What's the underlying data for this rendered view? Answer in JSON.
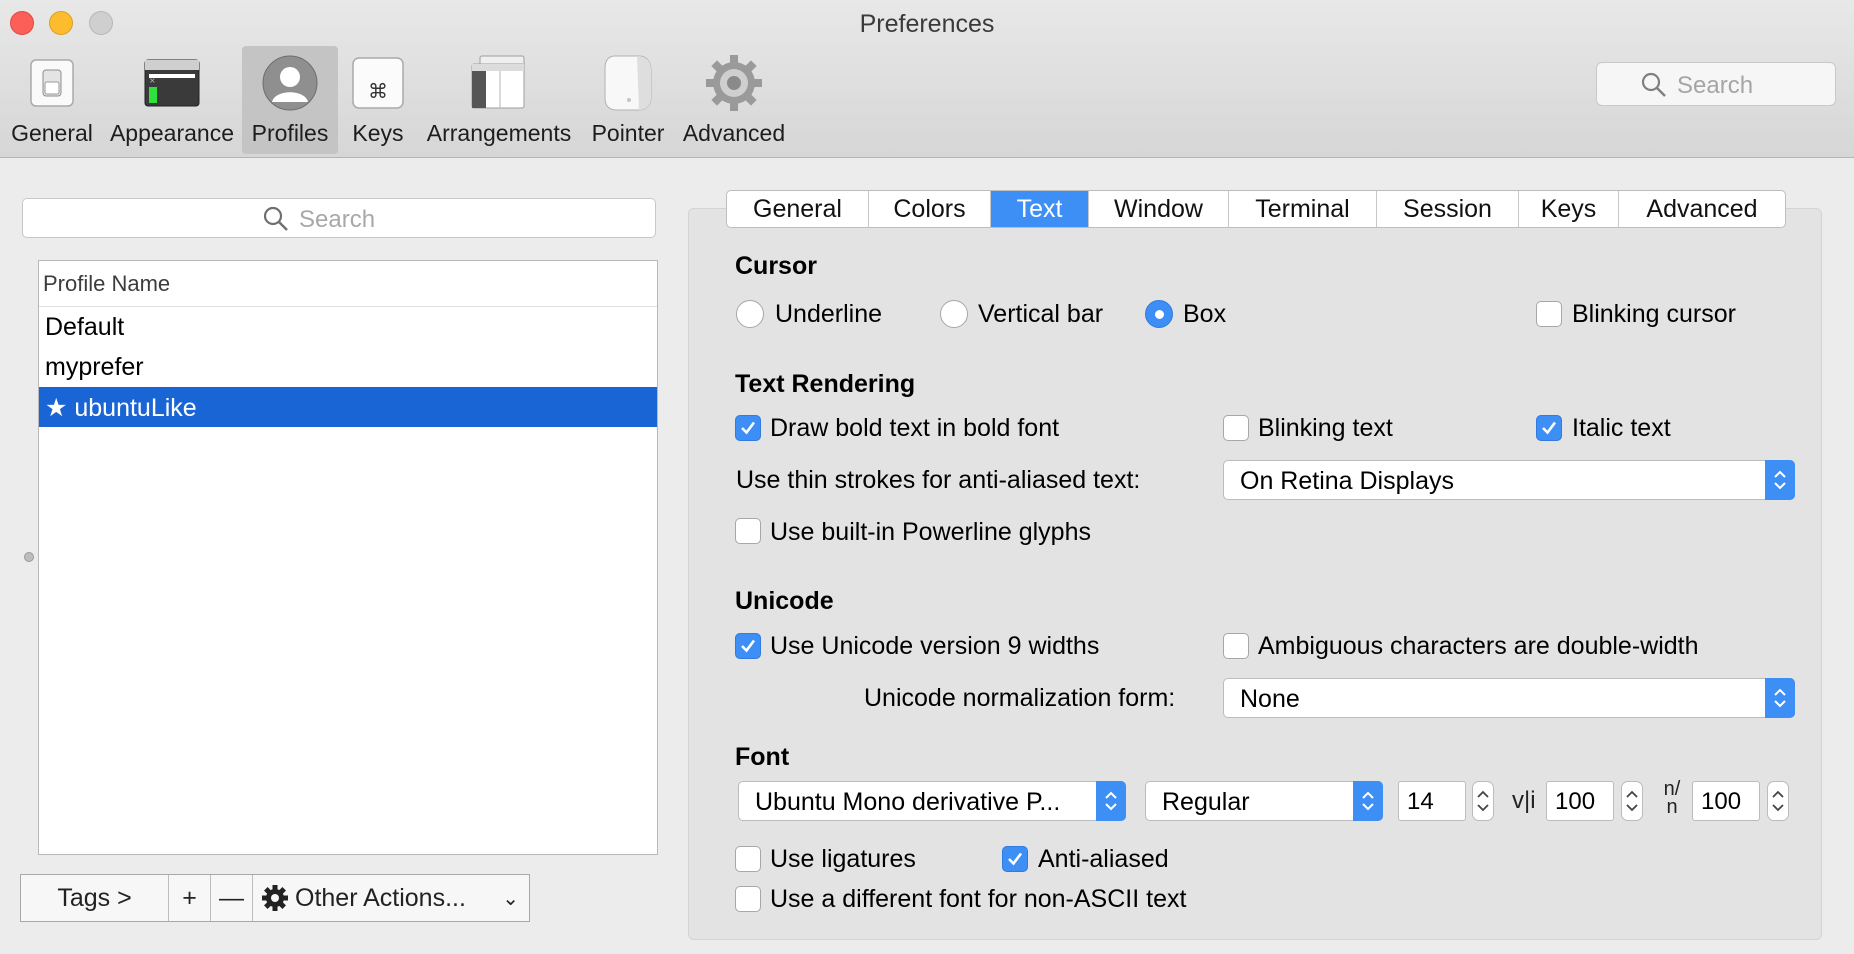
{
  "window": {
    "title": "Preferences"
  },
  "toolbar": {
    "items": [
      {
        "label": "General",
        "icon": "switch-icon"
      },
      {
        "label": "Appearance",
        "icon": "terminal-window-icon"
      },
      {
        "label": "Profiles",
        "icon": "user-silhouette-icon",
        "selected": true
      },
      {
        "label": "Keys",
        "icon": "command-key-icon"
      },
      {
        "label": "Arrangements",
        "icon": "windows-stack-icon"
      },
      {
        "label": "Pointer",
        "icon": "mouse-icon"
      },
      {
        "label": "Advanced",
        "icon": "gear-icon"
      }
    ],
    "search_placeholder": "Search"
  },
  "profiles": {
    "search_placeholder": "Search",
    "column_header": "Profile Name",
    "rows": [
      "Default",
      "myprefer",
      "★ ubuntuLike"
    ],
    "selected_index": 2
  },
  "bottom_bar": {
    "tags_label": "Tags >",
    "add_label": "+",
    "remove_label": "—",
    "actions_label": "Other Actions...",
    "actions_chevron": "⌄"
  },
  "tabs": {
    "items": [
      "General",
      "Colors",
      "Text",
      "Window",
      "Terminal",
      "Session",
      "Keys",
      "Advanced"
    ],
    "active": "Text"
  },
  "cursor": {
    "heading": "Cursor",
    "options": [
      "Underline",
      "Vertical bar",
      "Box"
    ],
    "selected": "Box",
    "blinking_label": "Blinking cursor",
    "blinking": false
  },
  "text_rendering": {
    "heading": "Text Rendering",
    "bold_label": "Draw bold text in bold font",
    "bold": true,
    "blinking_text_label": "Blinking text",
    "blinking_text": false,
    "italic_label": "Italic text",
    "italic": true,
    "thin_strokes_label": "Use thin strokes for anti-aliased text:",
    "thin_strokes_value": "On Retina Displays",
    "powerline_label": "Use built-in Powerline glyphs",
    "powerline": false
  },
  "unicode": {
    "heading": "Unicode",
    "v9_label": "Use Unicode version 9 widths",
    "v9": true,
    "ambiguous_label": "Ambiguous characters are double-width",
    "ambiguous": false,
    "normalization_label": "Unicode normalization form:",
    "normalization_value": "None"
  },
  "font": {
    "heading": "Font",
    "family": "Ubuntu Mono derivative P...",
    "style": "Regular",
    "size": "14",
    "vertical_spacing_glyph": "v|i",
    "vertical_spacing": "100",
    "horizontal_spacing_glyph": "n/n",
    "horizontal_spacing": "100",
    "ligatures_label": "Use ligatures",
    "ligatures": false,
    "antialiased_label": "Anti-aliased",
    "antialiased": true,
    "non_ascii_label": "Use a different font for non-ASCII text",
    "non_ascii": false
  },
  "colors": {
    "accent": "#3d8ef5",
    "selection": "#1965d6"
  }
}
